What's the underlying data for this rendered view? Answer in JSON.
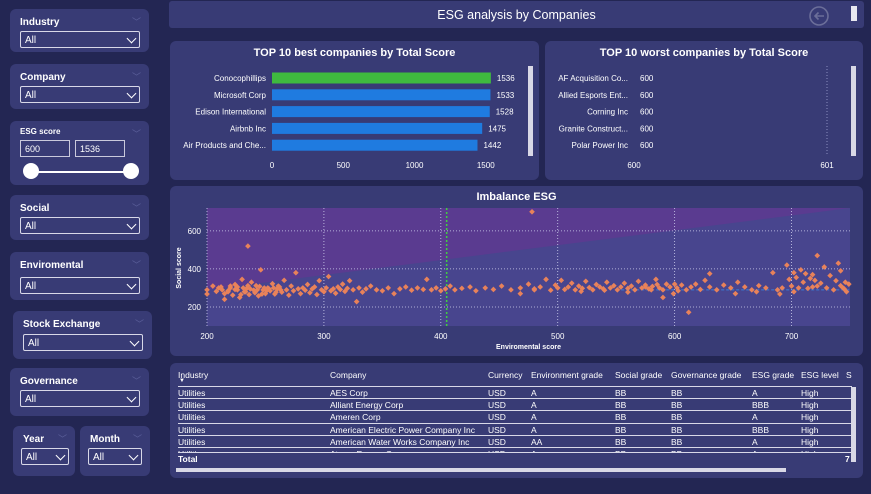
{
  "header": {
    "title": "ESG analysis by Companies"
  },
  "filters": {
    "industry": {
      "label": "Industry",
      "value": "All"
    },
    "company": {
      "label": "Company",
      "value": "All"
    },
    "esg_score": {
      "label": "ESG score",
      "min": "600",
      "max": "1536"
    },
    "social": {
      "label": "Social",
      "value": "All"
    },
    "environmental": {
      "label": "Enviromental",
      "value": "All"
    },
    "stock_exchange": {
      "label": "Stock Exchange",
      "value": "All"
    },
    "governance": {
      "label": "Governance",
      "value": "All"
    },
    "year": {
      "label": "Year",
      "value": "All"
    },
    "month": {
      "label": "Month",
      "value": "All"
    }
  },
  "chart_data": [
    {
      "type": "bar",
      "orientation": "horizontal",
      "title": "TOP 10 best companies by Total Score",
      "categories": [
        "Conocophillips",
        "Microsoft Corp",
        "Edison International",
        "Airbnb Inc",
        "Air Products and Che..."
      ],
      "values": [
        1536,
        1533,
        1528,
        1475,
        1442
      ],
      "colors": [
        "#3fba3f",
        "#1f7be0",
        "#1f7be0",
        "#1f7be0",
        "#1f7be0"
      ],
      "xticks": [
        "0",
        "500",
        "1000",
        "1500"
      ],
      "xlim": [
        0,
        1600
      ]
    },
    {
      "type": "bar",
      "orientation": "horizontal",
      "title": "TOP 10 worst companies by Total Score",
      "categories": [
        "AF Acquisition Co...",
        "Allied Esports Ent...",
        "Corning Inc",
        "Granite Construct...",
        "Polar Power Inc"
      ],
      "values": [
        600,
        600,
        600,
        600,
        600
      ],
      "xticks": [
        "600",
        "601"
      ],
      "xlim": [
        600,
        601
      ]
    },
    {
      "type": "scatter",
      "title": "Imbalance ESG",
      "xlabel": "Enviromental score",
      "ylabel": "Social score",
      "xlim": [
        200,
        750
      ],
      "ylim": [
        100,
        720
      ],
      "xticks": [
        200,
        300,
        400,
        500,
        600,
        700
      ],
      "yticks": [
        200,
        400,
        600
      ],
      "reference_x": 405,
      "reference_y": 290,
      "point_color": "#e8825a",
      "points": [
        [
          212,
          305
        ],
        [
          215,
          270
        ],
        [
          218,
          285
        ],
        [
          220,
          300
        ],
        [
          222,
          262
        ],
        [
          224,
          318
        ],
        [
          226,
          290
        ],
        [
          228,
          250
        ],
        [
          230,
          345
        ],
        [
          232,
          280
        ],
        [
          234,
          298
        ],
        [
          236,
          265
        ],
        [
          238,
          330
        ],
        [
          240,
          288
        ],
        [
          242,
          312
        ],
        [
          244,
          258
        ],
        [
          246,
          395
        ],
        [
          248,
          290
        ],
        [
          250,
          270
        ],
        [
          252,
          300
        ],
        [
          254,
          285
        ],
        [
          256,
          322
        ],
        [
          258,
          268
        ],
        [
          260,
          295
        ],
        [
          262,
          305
        ],
        [
          264,
          278
        ],
        [
          266,
          340
        ],
        [
          268,
          290
        ],
        [
          270,
          262
        ],
        [
          272,
          310
        ],
        [
          274,
          285
        ],
        [
          276,
          380
        ],
        [
          278,
          295
        ],
        [
          280,
          270
        ],
        [
          282,
          300
        ],
        [
          284,
          288
        ],
        [
          286,
          318
        ],
        [
          288,
          275
        ],
        [
          290,
          295
        ],
        [
          292,
          305
        ],
        [
          294,
          265
        ],
        [
          296,
          338
        ],
        [
          298,
          290
        ],
        [
          300,
          280
        ],
        [
          302,
          300
        ],
        [
          304,
          360
        ],
        [
          306,
          285
        ],
        [
          308,
          295
        ],
        [
          310,
          272
        ],
        [
          312,
          305
        ],
        [
          314,
          292
        ],
        [
          316,
          320
        ],
        [
          318,
          282
        ],
        [
          320,
          298
        ],
        [
          322,
          338
        ],
        [
          325,
          290
        ],
        [
          328,
          228
        ],
        [
          330,
          300
        ],
        [
          333,
          278
        ],
        [
          336,
          295
        ],
        [
          340,
          310
        ],
        [
          345,
          290
        ],
        [
          350,
          285
        ],
        [
          355,
          300
        ],
        [
          360,
          270
        ],
        [
          365,
          295
        ],
        [
          370,
          305
        ],
        [
          375,
          288
        ],
        [
          380,
          300
        ],
        [
          385,
          292
        ],
        [
          388,
          345
        ],
        [
          392,
          290
        ],
        [
          396,
          300
        ],
        [
          400,
          285
        ],
        [
          404,
          295
        ],
        [
          408,
          310
        ],
        [
          412,
          290
        ],
        [
          418,
          298
        ],
        [
          425,
          305
        ],
        [
          430,
          285
        ],
        [
          438,
          300
        ],
        [
          445,
          292
        ],
        [
          452,
          310
        ],
        [
          460,
          290
        ],
        [
          468,
          300
        ],
        [
          475,
          320
        ],
        [
          480,
          295
        ],
        [
          485,
          305
        ],
        [
          490,
          345
        ],
        [
          494,
          288
        ],
        [
          498,
          315
        ],
        [
          500,
          300
        ],
        [
          503,
          340
        ],
        [
          506,
          292
        ],
        [
          509,
          305
        ],
        [
          512,
          325
        ],
        [
          515,
          290
        ],
        [
          518,
          310
        ],
        [
          521,
          298
        ],
        [
          524,
          335
        ],
        [
          527,
          302
        ],
        [
          530,
          290
        ],
        [
          533,
          318
        ],
        [
          536,
          305
        ],
        [
          539,
          295
        ],
        [
          542,
          330
        ],
        [
          545,
          300
        ],
        [
          548,
          312
        ],
        [
          551,
          290
        ],
        [
          554,
          305
        ],
        [
          557,
          325
        ],
        [
          560,
          298
        ],
        [
          563,
          310
        ],
        [
          566,
          290
        ],
        [
          569,
          335
        ],
        [
          572,
          300
        ],
        [
          575,
          315
        ],
        [
          578,
          295
        ],
        [
          581,
          308
        ],
        [
          584,
          345
        ],
        [
          587,
          300
        ],
        [
          590,
          290
        ],
        [
          593,
          320
        ],
        [
          596,
          305
        ],
        [
          599,
          270
        ],
        [
          602,
          300
        ],
        [
          606,
          315
        ],
        [
          610,
          290
        ],
        [
          614,
          305
        ],
        [
          618,
          320
        ],
        [
          622,
          292
        ],
        [
          626,
          340
        ],
        [
          630,
          305
        ],
        [
          636,
          290
        ],
        [
          642,
          315
        ],
        [
          648,
          300
        ],
        [
          654,
          330
        ],
        [
          660,
          305
        ],
        [
          666,
          290
        ],
        [
          672,
          312
        ],
        [
          678,
          300
        ],
        [
          684,
          380
        ],
        [
          688,
          290
        ],
        [
          692,
          300
        ],
        [
          696,
          420
        ],
        [
          698,
          345
        ],
        [
          700,
          310
        ],
        [
          702,
          380
        ],
        [
          704,
          355
        ],
        [
          706,
          300
        ],
        [
          708,
          395
        ],
        [
          710,
          330
        ],
        [
          712,
          375
        ],
        [
          714,
          298
        ],
        [
          716,
          350
        ],
        [
          718,
          305
        ],
        [
          720,
          340
        ],
        [
          722,
          310
        ],
        [
          725,
          325
        ],
        [
          728,
          410
        ],
        [
          730,
          300
        ],
        [
          733,
          365
        ],
        [
          736,
          290
        ],
        [
          738,
          338
        ],
        [
          740,
          430
        ],
        [
          742,
          312
        ],
        [
          745,
          295
        ],
        [
          747,
          280
        ],
        [
          749,
          320
        ],
        [
          215,
          240
        ],
        [
          218,
          280
        ],
        [
          220,
          310
        ],
        [
          224,
          292
        ],
        [
          226,
          305
        ],
        [
          229,
          265
        ],
        [
          231,
          300
        ],
        [
          233,
          280
        ],
        [
          235,
          312
        ],
        [
          237,
          295
        ],
        [
          241,
          275
        ],
        [
          243,
          290
        ],
        [
          245,
          308
        ],
        [
          247,
          268
        ],
        [
          249,
          300
        ],
        [
          251,
          285
        ],
        [
          253,
          295
        ],
        [
          257,
          300
        ],
        [
          259,
          278
        ],
        [
          261,
          310
        ],
        [
          263,
          290
        ],
        [
          235,
          520
        ],
        [
          478,
          700
        ],
        [
          575,
          305
        ],
        [
          580,
          290
        ],
        [
          585,
          318
        ],
        [
          590,
          250
        ],
        [
          600,
          320
        ],
        [
          603,
          285
        ],
        [
          612,
          172
        ],
        [
          630,
          375
        ],
        [
          468,
          270
        ],
        [
          480,
          290
        ],
        [
          520,
          282
        ],
        [
          540,
          288
        ],
        [
          560,
          278
        ],
        [
          652,
          270
        ],
        [
          670,
          280
        ],
        [
          690,
          268
        ],
        [
          702,
          280
        ],
        [
          718,
          370
        ],
        [
          722,
          470
        ],
        [
          744,
          300
        ],
        [
          746,
          330
        ],
        [
          742,
          390
        ],
        [
          200,
          268
        ],
        [
          200,
          290
        ],
        [
          205,
          310
        ],
        [
          208,
          282
        ],
        [
          210,
          300
        ],
        [
          213,
          290
        ]
      ]
    }
  ],
  "table": {
    "columns": [
      "Industry",
      "Company",
      "Currency",
      "Environment grade",
      "Social grade",
      "Governance grade",
      "ESG grade",
      "ESG level",
      "S"
    ],
    "rows": [
      [
        "Utilities",
        "AES Corp",
        "USD",
        "A",
        "BB",
        "BB",
        "A",
        "High"
      ],
      [
        "Utilities",
        "Alliant Energy Corp",
        "USD",
        "A",
        "BB",
        "BB",
        "BBB",
        "High"
      ],
      [
        "Utilities",
        "Ameren Corp",
        "USD",
        "A",
        "BB",
        "BB",
        "A",
        "High"
      ],
      [
        "Utilities",
        "American Electric Power Company Inc",
        "USD",
        "A",
        "BB",
        "BB",
        "BBB",
        "High"
      ],
      [
        "Utilities",
        "American Water Works Company Inc",
        "USD",
        "AA",
        "BB",
        "BB",
        "A",
        "High"
      ],
      [
        "Utilities",
        "Atmos Energy Corp",
        "USD",
        "A",
        "BB",
        "BB",
        "A",
        "High"
      ]
    ],
    "total_label": "Total",
    "total_value": "7"
  }
}
